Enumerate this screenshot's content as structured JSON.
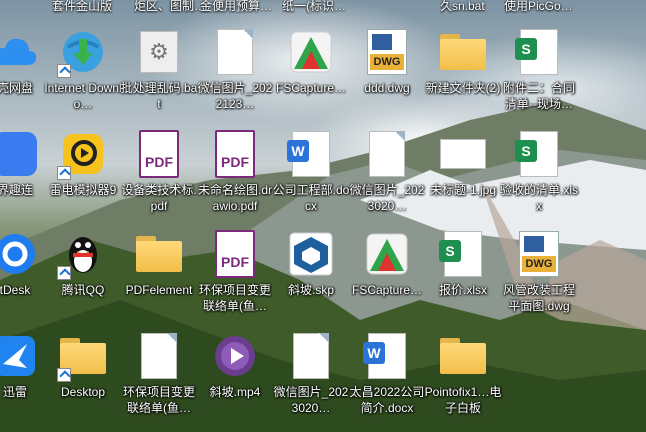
{
  "top_strip": [
    {
      "text": "套件金山版"
    },
    {
      "text": "炬区、图制…"
    },
    {
      "text": "金便用预算…"
    },
    {
      "text": "纸一(标识…"
    },
    {
      "text": "久sn.bat"
    },
    {
      "text": "使用PicGo…"
    }
  ],
  "icons": [
    {
      "label": "壳网盘",
      "icon": "cloud-icon"
    },
    {
      "label": "Internet Downlo…",
      "icon": "internet-download-manager-icon"
    },
    {
      "label": "批处理乱码.bat",
      "icon": "batch-file-gear-icon"
    },
    {
      "label": "微信图片_2022123…",
      "icon": "image-file-icon"
    },
    {
      "label": "FSCapture…",
      "icon": "fscapture-icon"
    },
    {
      "label": "ddd.dwg",
      "icon": "dwg-file-icon"
    },
    {
      "label": "新建文件夹(2)",
      "icon": "folder-icon"
    },
    {
      "label": "附件二：合同清单--现场…",
      "icon": "spreadsheet-icon"
    },
    {
      "label": "界趣连",
      "icon": "send-app-icon"
    },
    {
      "label": "雷电模拟器9",
      "icon": "ldplayer-icon"
    },
    {
      "label": "设备类技术标.pdf",
      "icon": "pdf-icon"
    },
    {
      "label": "未命名绘图.drawio.pdf",
      "icon": "pdf-icon"
    },
    {
      "label": "公司工程部.docx",
      "icon": "docx-icon"
    },
    {
      "label": "微信图片_2023020…",
      "icon": "image-file-icon"
    },
    {
      "label": "未标题-1.jpg",
      "icon": "image-file-icon"
    },
    {
      "label": "验收的清单.xlsx",
      "icon": "spreadsheet-icon"
    },
    {
      "label": "tDesk",
      "icon": "todesk-icon"
    },
    {
      "label": "腾讯QQ",
      "icon": "qq-penguin-icon"
    },
    {
      "label": "PDFelement",
      "icon": "folder-icon"
    },
    {
      "label": "环保项目变更联络单(鱼…",
      "icon": "pdf-icon"
    },
    {
      "label": "斜坡.skp",
      "icon": "sketchup-icon"
    },
    {
      "label": "FSCapture…",
      "icon": "fscapture-icon"
    },
    {
      "label": "报价.xlsx",
      "icon": "spreadsheet-icon"
    },
    {
      "label": "风管改装工程平面图.dwg",
      "icon": "dwg-file-icon"
    },
    {
      "label": "迅雷",
      "icon": "thunder-icon"
    },
    {
      "label": "Desktop",
      "icon": "folder-icon"
    },
    {
      "label": "环保项目变更联络单(鱼…",
      "icon": "document-icon"
    },
    {
      "label": "斜坡.mp4",
      "icon": "video-play-icon"
    },
    {
      "label": "微信图片_2023020…",
      "icon": "image-file-icon"
    },
    {
      "label": "太昌2022公司简介.docx",
      "icon": "docx-icon"
    },
    {
      "label": "Pointofix1…电子白板",
      "icon": "folder-icon"
    }
  ],
  "badges": {
    "pdf": "PDF",
    "dwg": "DWG",
    "xls": "S",
    "docx": "W"
  },
  "colors": {
    "accent_blue": "#1a6fd1",
    "pdf_purple": "#7b2a7b",
    "excel_green": "#1d8f4e",
    "word_blue": "#2b73d6",
    "folder_yellow": "#f1be4a"
  }
}
